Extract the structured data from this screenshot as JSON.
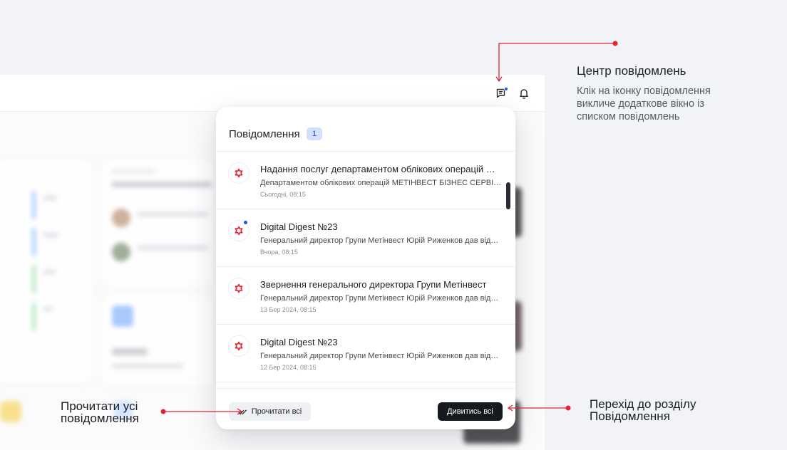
{
  "popup": {
    "title": "Повідомлення",
    "count": "1",
    "items": [
      {
        "title": "Надання послуг департаментом облікових операцій МЕТІНВЕСТ БІЗНЕС СЕРВІС",
        "text": "Департаментом облікових операцій МЕТІНВЕСТ БІЗНЕС СЕРВІС надає послуги",
        "time": "Сьогодні, 08:15",
        "unread": false,
        "icon": "metinvest-logo-icon"
      },
      {
        "title": "Digital Digest №23",
        "text": "Генеральний директор Групи Метінвест Юрій Риженков дав відповіді",
        "time": "Вчора, 08:15",
        "unread": true,
        "icon": "metinvest-logo-icon"
      },
      {
        "title": "Звернення генерального директора Групи Метінвест",
        "text": "Генеральний директор Групи Метінвест Юрій Риженков дав відповіді",
        "time": "13 Бер 2024, 08:15",
        "unread": false,
        "icon": "metinvest-logo-icon"
      },
      {
        "title": "Digital Digest №23",
        "text": "Генеральний директор Групи Метінвест Юрій Риженков дав відповіді",
        "time": "12 Бер 2024, 08:15",
        "unread": false,
        "icon": "metinvest-logo-icon"
      }
    ],
    "read_all_label": "Прочитати всі",
    "view_all_label": "Дивитись всі"
  },
  "header": {
    "icons": [
      "notification-center-icon",
      "bell-icon"
    ]
  },
  "annotations": {
    "center_title": "Центр повідомлень",
    "center_desc": "Клік на іконку повідомлення викличе додаткове вікно із списком повідомлень",
    "read_all": "Прочитати усі повідомлення",
    "view_all": "Перехід до розділу Повідомлення"
  },
  "colors": {
    "accent": "#1a55e6",
    "annotation": "#e02434",
    "brand": "#e02434",
    "dark_button": "#16191e"
  }
}
